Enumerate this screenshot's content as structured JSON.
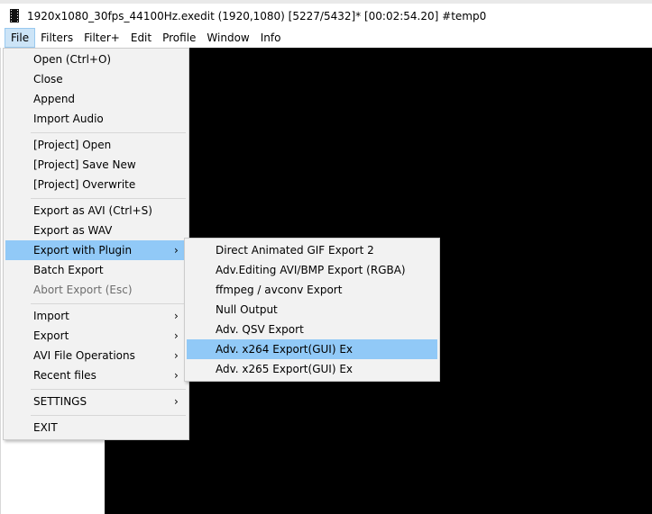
{
  "window": {
    "title": "1920x1080_30fps_44100Hz.exedit (1920,1080)  [5227/5432]* [00:02:54.20]  #temp0"
  },
  "menubar": {
    "items": [
      "File",
      "Filters",
      "Filter+",
      "Edit",
      "Profile",
      "Window",
      "Info"
    ],
    "active": "File"
  },
  "file_menu": {
    "open": "Open (Ctrl+O)",
    "close": "Close",
    "append": "Append",
    "import_audio": "Import Audio",
    "project_open": "[Project] Open",
    "project_save_new": "[Project] Save New",
    "project_overwrite": "[Project] Overwrite",
    "export_avi": "Export as AVI (Ctrl+S)",
    "export_wav": "Export as WAV",
    "export_with_plugin": "Export with Plugin",
    "batch_export": "Batch Export",
    "abort_export": "Abort Export (Esc)",
    "import": "Import",
    "export": "Export",
    "avi_file_operations": "AVI File Operations",
    "recent_files": "Recent files",
    "settings": "SETTINGS",
    "exit": "EXIT",
    "arrow": "›"
  },
  "plugin_submenu": {
    "items": [
      "Direct Animated GIF Export 2",
      "Adv.Editing AVI/BMP Export (RGBA)",
      "ffmpeg / avconv Export",
      "Null Output",
      "Adv. QSV Export",
      "Adv. x264 Export(GUI) Ex",
      "Adv. x265 Export(GUI) Ex"
    ],
    "highlighted": "Adv. x264 Export(GUI) Ex"
  },
  "colors": {
    "menu_bg": "#f2f2f2",
    "highlight": "#91c9f7",
    "menubar_active": "#cce4f7",
    "video_bg": "#000000"
  }
}
